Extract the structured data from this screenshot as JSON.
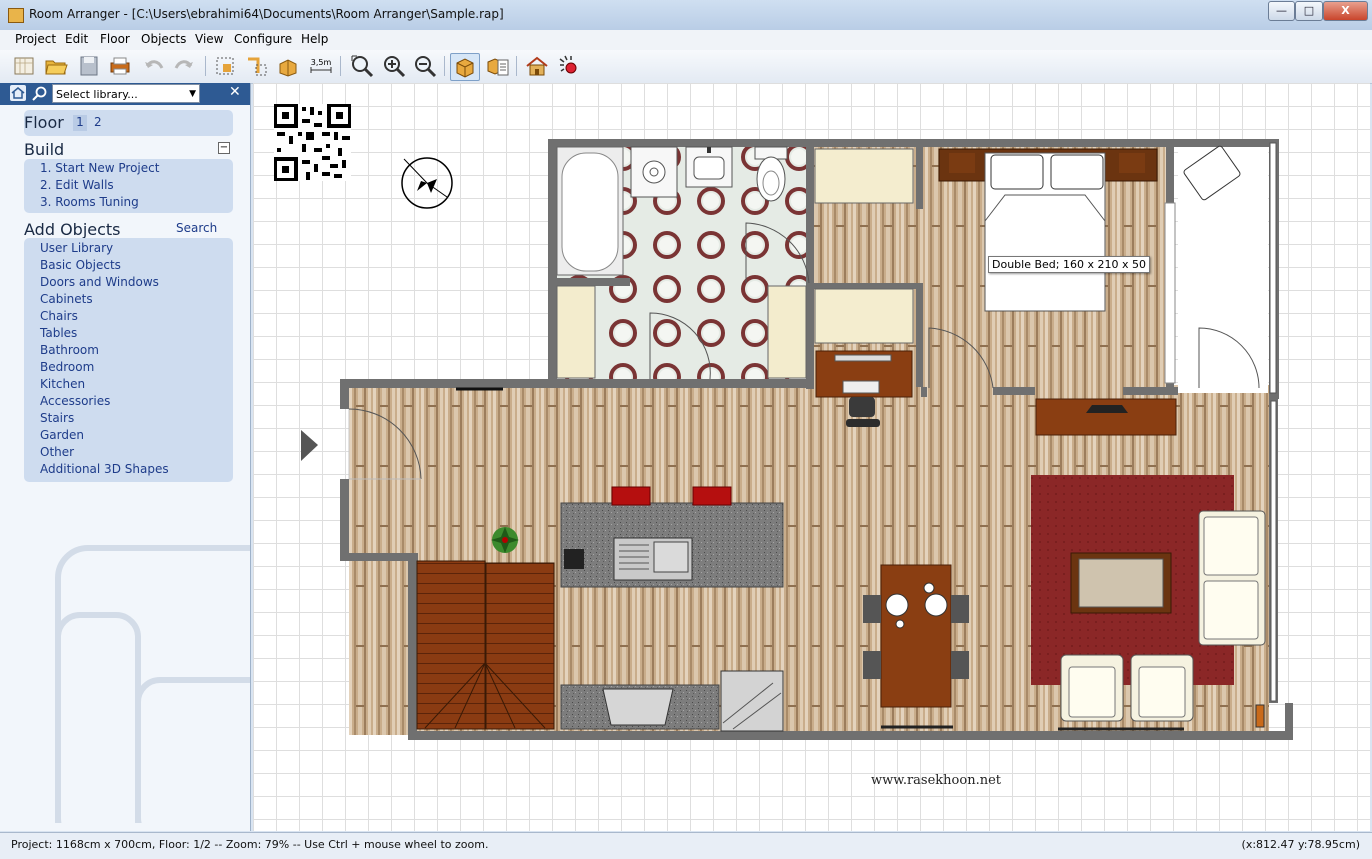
{
  "window": {
    "title": "Room Arranger - [C:\\Users\\ebrahimi64\\Documents\\Room Arranger\\Sample.rap]",
    "minimize_label": "—",
    "maximize_label": "□",
    "close_label": "X"
  },
  "menu": [
    "Project",
    "Edit",
    "Floor",
    "Objects",
    "View",
    "Configure",
    "Help"
  ],
  "toolbar": {
    "icons": [
      "new-project-icon",
      "open-icon",
      "save-icon",
      "print-icon",
      "undo-icon",
      "redo-icon",
      "room-tool-icon",
      "wall-tool-icon",
      "objects-tool-icon",
      "measure-icon",
      "zoom-fit-icon",
      "zoom-in-icon",
      "zoom-out-icon",
      "3d-box-icon",
      "object-list-icon",
      "3d-view-icon",
      "render-icon"
    ],
    "measure_label": "3,5m"
  },
  "sidebar": {
    "library_placeholder": "Select library...",
    "close_label": "✕",
    "floor_title": "Floor",
    "floors": [
      "1",
      "2"
    ],
    "build_title": "Build",
    "build_collapse": "−",
    "build_items": [
      "1. Start New Project",
      "2. Edit Walls",
      "3. Rooms Tuning"
    ],
    "add_objects_title": "Add Objects",
    "search_label": "Search",
    "object_categories": [
      "User Library",
      "Basic Objects",
      "Doors and Windows",
      "Cabinets",
      "Chairs",
      "Tables",
      "Bathroom",
      "Bedroom",
      "Kitchen",
      "Accessories",
      "Stairs",
      "Garden",
      "Other",
      "Additional 3D Shapes"
    ]
  },
  "canvas": {
    "tooltip": "Double Bed; 160 x 210 x 50",
    "watermark": "www.rasekhoon.net"
  },
  "status": {
    "left": "Project: 1168cm x 700cm, Floor: 1/2 -- Zoom: 79% -- Use Ctrl + mouse wheel to zoom.",
    "right": "(x:812.47 y:78.95cm)"
  },
  "colors": {
    "titlebar": "#b9cde6",
    "sidebar_header": "#2e5a93",
    "wall": "#707070",
    "rug": "#8b2323",
    "link": "#1e3c8a"
  }
}
